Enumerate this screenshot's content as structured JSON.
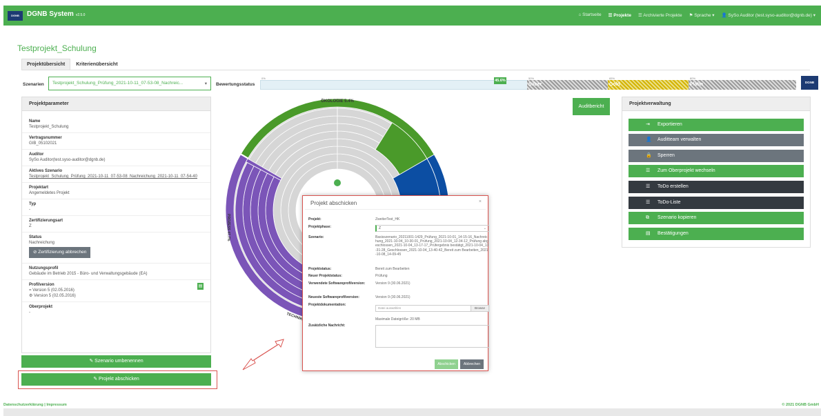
{
  "topbar": {
    "logo": "DGNB",
    "title": "DGNB System",
    "version": "v2.5.0",
    "nav": [
      {
        "icon": "home-icon",
        "glyph": "⌂",
        "label": "Startseite",
        "active": false
      },
      {
        "icon": "list-icon",
        "glyph": "☰",
        "label": "Projekte",
        "active": true
      },
      {
        "icon": "list-icon",
        "glyph": "☰",
        "label": "Archivierte Projekte",
        "active": false
      },
      {
        "icon": "flag-icon",
        "glyph": "⚑",
        "label": "Sprache",
        "active": false,
        "caret": "▾"
      },
      {
        "icon": "user-icon",
        "glyph": "👤",
        "label": "SySo Auditor (test.syso-auditor@dgnb.de)",
        "active": false,
        "caret": "▾"
      }
    ]
  },
  "page": {
    "title": "Testprojekt_Schulung",
    "tabs": [
      "Projektübersicht",
      "Kriterienübersicht"
    ]
  },
  "scenario": {
    "label": "Szenarien",
    "value": "Testprojekt_Schulung_Prüfung_2021-10-11_07-53-08_Nachreic...",
    "caret": "▾"
  },
  "bewertung": {
    "label": "Bewertungsstatus",
    "percent": "45.6%",
    "percent_value": 45.6,
    "zones": [
      "Silber",
      "Gold",
      "Platin"
    ],
    "ticks": [
      "0%",
      "50%",
      "65%",
      "80%"
    ]
  },
  "params": {
    "heading": "Projektparameter",
    "name_label": "Name",
    "name_value": "Testprojekt_Schulung",
    "vn_label": "Vertragsnummer",
    "vn_value": "GIB_05102021",
    "auditor_label": "Auditor",
    "auditor_value": "SySo Auditor(test.syso-auditor@dgnb.de)",
    "aktiv_label": "Aktives Szenario",
    "aktiv_value": "Testprojekt_Schulung_Prüfung_2021-10-11_07-53-08_Nachreichung_2021-10-11_07-54-40",
    "art_label": "Projektart",
    "art_value": "Angemeldetes Projekt",
    "typ_label": "Typ",
    "typ_value": "-",
    "zert_label": "Zertifizierungsart",
    "zert_value": "Z",
    "status_label": "Status",
    "status_value": "Nachreichung",
    "abbrechen_button": "Zertifizierung abbrechen",
    "nutz_label": "Nutzungsprofil",
    "nutz_value": "Gebäude im Betrieb 2015 - Büro- und Verwaltungsgebäude (EA)",
    "profil_label": "Profilversion",
    "profil_v1": "Version 5 (02.05.2016)",
    "profil_v2": "Version 5 (02.05.2016)",
    "ober_label": "Oberprojekt",
    "ober_value": "-"
  },
  "buttons": {
    "rename": "Szenario umbenennen",
    "submit_project": "Projekt abschicken",
    "auditbericht": "Auditbericht"
  },
  "verwaltung": {
    "heading": "Projektverwaltung",
    "items": [
      {
        "label": "Exportieren",
        "style": "green",
        "glyph": "⇥"
      },
      {
        "label": "Auditteam verwalten",
        "style": "grey",
        "glyph": "👤"
      },
      {
        "label": "Sperren",
        "style": "grey",
        "glyph": "🔒"
      },
      {
        "label": "Zum Oberprojekt wechseln",
        "style": "green",
        "glyph": "☰"
      },
      {
        "label": "ToDo erstellen",
        "style": "dark",
        "glyph": "☰"
      },
      {
        "label": "ToDo-Liste",
        "style": "dark",
        "glyph": "☰"
      },
      {
        "label": "Szenario kopieren",
        "style": "green",
        "glyph": "⧉"
      },
      {
        "label": "Bestätigungen",
        "style": "green",
        "glyph": "▤"
      }
    ]
  },
  "chart_data": {
    "type": "pie",
    "segments": [
      {
        "label": "ÖKOLOGIE 5.4%",
        "color": "#4a9a2a"
      },
      {
        "label": "PROZESS 47.7%",
        "color": "#7b55b8"
      },
      {
        "label": "TECHNIK",
        "color": "#12a0a8"
      }
    ],
    "colors": {
      "oekologie": "#4a9a2a",
      "prozess": "#7b55b8",
      "technik": "#12a0a8",
      "blue": "#0c4ea3",
      "ring": "#d6d6d6"
    }
  },
  "modal": {
    "title": "Projekt abschicken",
    "close": "×",
    "projekt_label": "Projekt:",
    "projekt_value": "ZweiterTest_HK",
    "phase_label": "Projektphase:",
    "phase_value": "Z",
    "szenario_label": "Szenario:",
    "szenario_value": "Basisszenario_20211001-1429_Prüfung_2021-10-01_14-15-16_Nachreichung_2021-10-04_10-30-01_Prüfung_2021-10-04_12-34-12_Prüfung abgeschlossen_2021-10-04_13-17-17_Prüfergebnis bestätigt_2021-10-04_13-31-28_Geschlossen_2021-10-04_13-40-42_Bereit zum Bearbeiten_2021-10-08_14-09-45",
    "status_label": "Projektstatus:",
    "status_value": "Bereit zum Bearbeiten",
    "neu_label": "Neuer Projektstatus:",
    "neu_value": "Prüfung",
    "sw_label": "Verwendete Softwareprofilversion:",
    "sw_value": "Version 9 (30.06.2021)",
    "newest_label": "Neueste Softwareprofilversion:",
    "newest_value": "Version 9 (30.06.2021)",
    "doc_label": "Projektdokumentation:",
    "doc_placeholder": "Datei auswählen",
    "browse": "Browse",
    "max_size": "Maximale Dateigröße: 20 MB",
    "msg_label": "Zusätzliche Nachricht:",
    "submit": "Abschicken",
    "cancel": "Abbrechen"
  },
  "footer": {
    "left": "Datenschutzerklärung | Impressum",
    "right": "© 2021 DGNB GmbH"
  }
}
